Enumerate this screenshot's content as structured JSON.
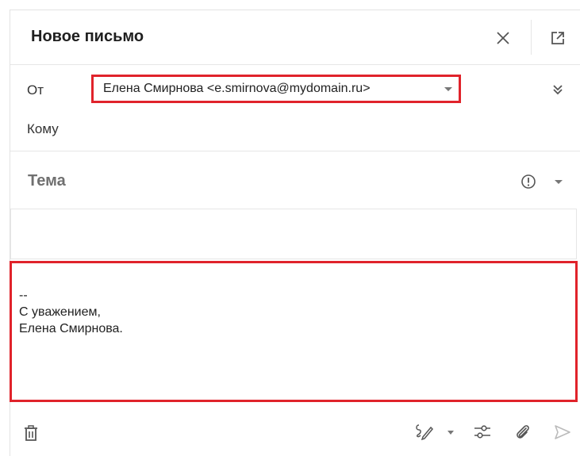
{
  "header": {
    "title": "Новое письмо",
    "close_icon": "close-icon",
    "popout_icon": "popout-icon"
  },
  "from": {
    "label": "От",
    "value": "Елена Смирнова <e.smirnova@mydomain.ru>",
    "expand_icon": "double-chevron-down-icon"
  },
  "to": {
    "label": "Кому",
    "value": ""
  },
  "subject": {
    "placeholder": "Тема",
    "value": "",
    "priority_icon": "exclamation-circle-icon"
  },
  "body": {
    "signature_lines": [
      "--",
      "С уважением,",
      "Елена Смирнова."
    ]
  },
  "footer": {
    "icons": [
      "trash-icon",
      "signature-pen-icon",
      "sliders-icon",
      "paperclip-icon",
      "send-icon"
    ]
  },
  "colors": {
    "highlight": "#e0232b",
    "icon": "#666666",
    "border": "#e6e6e6"
  }
}
